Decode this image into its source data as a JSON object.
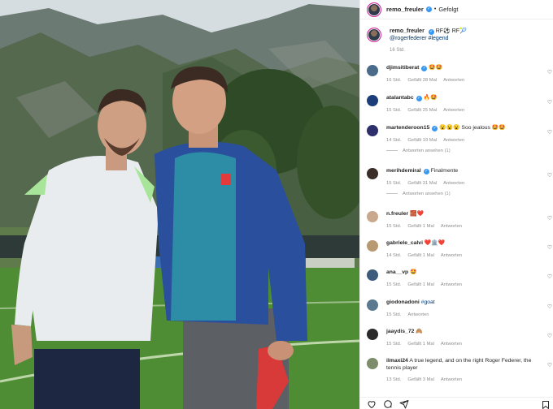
{
  "header": {
    "username": "remo_freuler",
    "separator": "•",
    "follow_status": "Gefolgt"
  },
  "caption": {
    "username": "remo_freuler",
    "text_1": "RF⚽ RF🎾",
    "mention": "@rogerfederer",
    "hashtag": "#legend",
    "time": "16 Std."
  },
  "comments": [
    {
      "username": "djimsitiberat",
      "verified": true,
      "text": "🤩🤩",
      "time": "16 Std.",
      "likes": "Gefällt 28 Mal",
      "reply": "Antworten",
      "av_color": "#4a6c8a"
    },
    {
      "username": "atalantabc",
      "verified": true,
      "text": "🔥🤩",
      "time": "15 Std.",
      "likes": "Gefällt 25 Mal",
      "reply": "Antworten",
      "av_color": "#1b3d7a"
    },
    {
      "username": "martenderoon15",
      "verified": true,
      "text": "😮😮😮 Soo jealous 🤩🤩",
      "time": "14 Std.",
      "likes": "Gefällt 19 Mal",
      "reply": "Antworten",
      "view_replies": "Antworten ansehen (1)",
      "av_color": "#2d2f6b"
    },
    {
      "username": "merihdemiral",
      "verified": true,
      "text": "Finalmente",
      "time": "15 Std.",
      "likes": "Gefällt 31 Mal",
      "reply": "Antworten",
      "view_replies": "Antworten ansehen (1)",
      "av_color": "#3b2d28"
    },
    {
      "username": "n.freuler",
      "verified": false,
      "text": "🧱❤️",
      "time": "15 Std.",
      "likes": "Gefällt 1 Mal",
      "reply": "Antworten",
      "av_color": "#c9a88d"
    },
    {
      "username": "gabriele_calvi",
      "verified": false,
      "text": "❤️🏛️❤️",
      "time": "14 Std.",
      "likes": "Gefällt 1 Mal",
      "reply": "Antworten",
      "av_color": "#b89a72"
    },
    {
      "username": "ana__vp",
      "verified": false,
      "text": "🤩",
      "time": "15 Std.",
      "likes": "Gefällt 1 Mal",
      "reply": "Antworten",
      "av_color": "#3d5b7a"
    },
    {
      "username": "giodonadoni",
      "verified": false,
      "text": "#goat",
      "text_is_tag": true,
      "time": "15 Std.",
      "likes": "",
      "reply": "Antworten",
      "av_color": "#5a7a92"
    },
    {
      "username": "jaaydis_72",
      "verified": false,
      "text": "🙈",
      "time": "15 Std.",
      "likes": "Gefällt 1 Mal",
      "reply": "Antworten",
      "av_color": "#2a2a2a"
    },
    {
      "username": "ilmaxi24",
      "verified": false,
      "text": "A true legend, and on the right Roger Federer, the tennis player",
      "time": "13 Std.",
      "likes": "Gefällt 3 Mal",
      "reply": "Antworten",
      "av_color": "#7d8c6a"
    }
  ],
  "icons": {
    "like": "heart-icon",
    "comment": "comment-icon",
    "share": "share-icon",
    "save": "bookmark-icon"
  }
}
